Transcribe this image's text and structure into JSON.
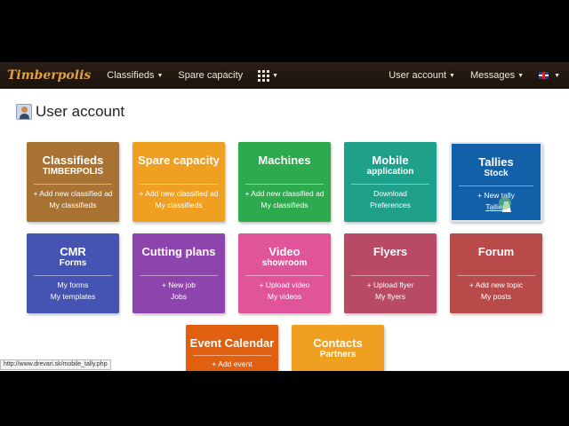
{
  "navbar": {
    "brand": "Timberpolis",
    "items": [
      {
        "label": "Classifieds"
      },
      {
        "label": "Spare capacity"
      }
    ],
    "right": [
      {
        "label": "User account"
      },
      {
        "label": "Messages"
      }
    ]
  },
  "page": {
    "title": "User account"
  },
  "tiles": [
    {
      "title": "Classifieds",
      "sub": "TIMBERPOLIS",
      "links": [
        "+ Add new classified ad",
        "My classifieds"
      ],
      "color": "#a87232"
    },
    {
      "title": "Spare capacity",
      "sub": "",
      "links": [
        "+ Add new classified ad",
        "My classifieds"
      ],
      "color": "#f0a020"
    },
    {
      "title": "Machines",
      "sub": "",
      "links": [
        "+ Add new classified ad",
        "My classifieds"
      ],
      "color": "#2eaa4e"
    },
    {
      "title": "Mobile",
      "sub": "application",
      "links": [
        "Download",
        "Preferences"
      ],
      "color": "#1fa08a"
    },
    {
      "title": "Tallies",
      "sub": "Stock",
      "links": [
        "+ New tally",
        "Tallies"
      ],
      "color": "#1260a8"
    },
    {
      "title": "CMR",
      "sub": "Forms",
      "links": [
        "My forms",
        "My templates"
      ],
      "color": "#4553b2"
    },
    {
      "title": "Cutting plans",
      "sub": "",
      "links": [
        "+ New job",
        "Jobs"
      ],
      "color": "#8e44ad"
    },
    {
      "title": "Video",
      "sub": "showroom",
      "links": [
        "+ Upload video",
        "My videos"
      ],
      "color": "#e0559a"
    },
    {
      "title": "Flyers",
      "sub": "",
      "links": [
        "+ Upload flyer",
        "My flyers"
      ],
      "color": "#b84a66"
    },
    {
      "title": "Forum",
      "sub": "",
      "links": [
        "+ Add new topic",
        "My posts"
      ],
      "color": "#b84a4a"
    },
    {
      "title": "Event Calendar",
      "sub": "",
      "links": [
        "+ Add event"
      ],
      "color": "#e06010"
    },
    {
      "title": "Contacts",
      "sub": "Partners",
      "links": [],
      "color": "#f0a020"
    }
  ],
  "status": {
    "url": "http://www.drevari.sk/mobile_tally.php"
  }
}
